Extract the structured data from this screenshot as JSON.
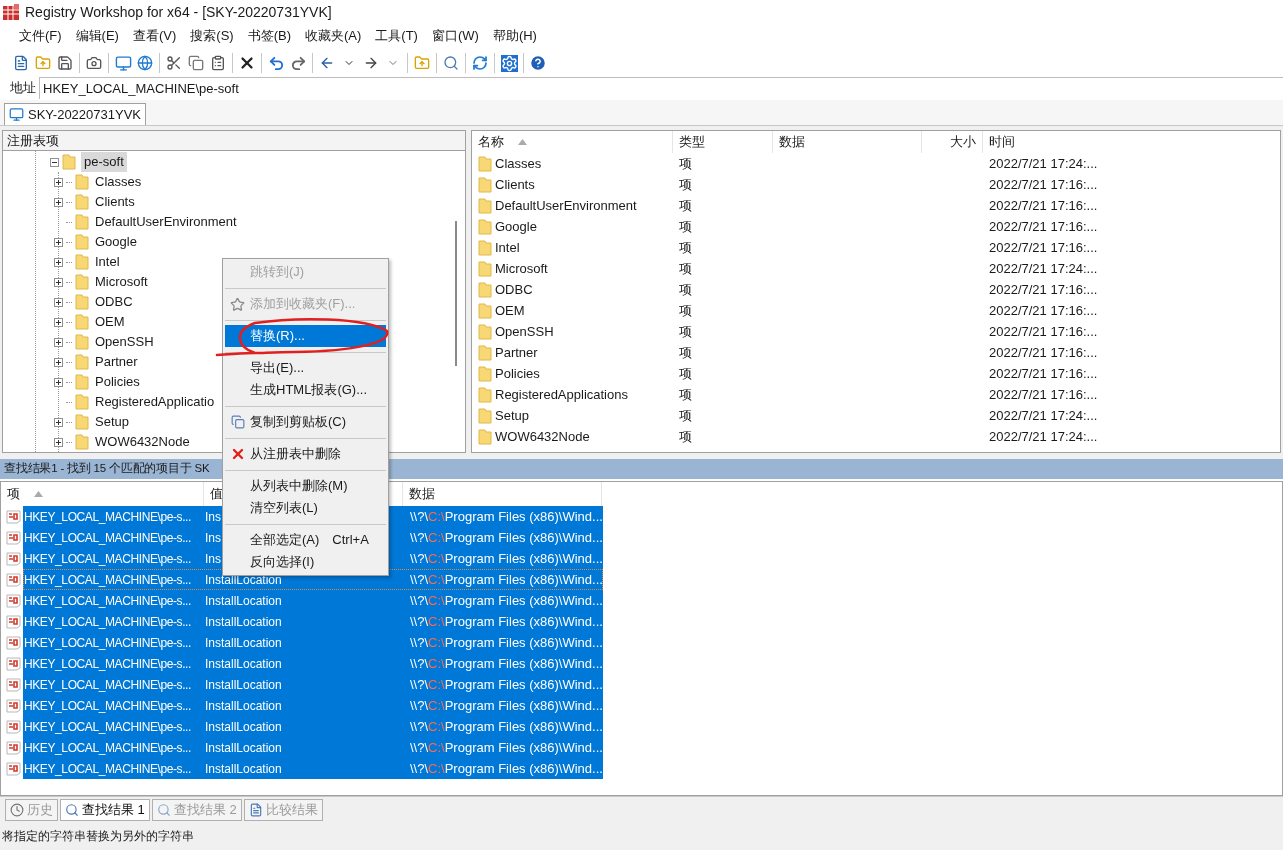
{
  "window": {
    "title": "Registry Workshop for x64 - [SKY-20220731YVK]"
  },
  "menu": [
    "文件(F)",
    "编辑(E)",
    "查看(V)",
    "搜索(S)",
    "书签(B)",
    "收藏夹(A)",
    "工具(T)",
    "窗口(W)",
    "帮助(H)"
  ],
  "address": {
    "label": "地址",
    "value": "HKEY_LOCAL_MACHINE\\pe-soft"
  },
  "computer_tab": {
    "label": "SKY-20220731YVK",
    "selected": true
  },
  "tree": {
    "header": "注册表项",
    "items": [
      {
        "label": "pe-soft",
        "selected": true,
        "expanded": true,
        "children": [
          {
            "label": "Classes",
            "expandable": true
          },
          {
            "label": "Clients",
            "expandable": true
          },
          {
            "label": "DefaultUserEnvironment",
            "expandable": false
          },
          {
            "label": "Google",
            "expandable": true
          },
          {
            "label": "Intel",
            "expandable": true
          },
          {
            "label": "Microsoft",
            "expandable": true
          },
          {
            "label": "ODBC",
            "expandable": true
          },
          {
            "label": "OEM",
            "expandable": true
          },
          {
            "label": "OpenSSH",
            "expandable": true
          },
          {
            "label": "Partner",
            "expandable": true
          },
          {
            "label": "Policies",
            "expandable": true
          },
          {
            "label": "RegisteredApplicatio",
            "expandable": false
          },
          {
            "label": "Setup",
            "expandable": true
          },
          {
            "label": "WOW6432Node",
            "expandable": true
          }
        ]
      }
    ]
  },
  "list": {
    "columns": [
      "名称",
      "类型",
      "数据",
      "大小",
      "时间"
    ],
    "rows": [
      {
        "name": "Classes",
        "type": "项",
        "time": "2022/7/21 17:24:..."
      },
      {
        "name": "Clients",
        "type": "项",
        "time": "2022/7/21 17:16:..."
      },
      {
        "name": "DefaultUserEnvironment",
        "type": "项",
        "time": "2022/7/21 17:16:..."
      },
      {
        "name": "Google",
        "type": "项",
        "time": "2022/7/21 17:16:..."
      },
      {
        "name": "Intel",
        "type": "项",
        "time": "2022/7/21 17:16:..."
      },
      {
        "name": "Microsoft",
        "type": "项",
        "time": "2022/7/21 17:24:..."
      },
      {
        "name": "ODBC",
        "type": "项",
        "time": "2022/7/21 17:16:..."
      },
      {
        "name": "OEM",
        "type": "项",
        "time": "2022/7/21 17:16:..."
      },
      {
        "name": "OpenSSH",
        "type": "项",
        "time": "2022/7/21 17:16:..."
      },
      {
        "name": "Partner",
        "type": "项",
        "time": "2022/7/21 17:16:..."
      },
      {
        "name": "Policies",
        "type": "项",
        "time": "2022/7/21 17:16:..."
      },
      {
        "name": "RegisteredApplications",
        "type": "项",
        "time": "2022/7/21 17:16:..."
      },
      {
        "name": "Setup",
        "type": "项",
        "time": "2022/7/21 17:24:..."
      },
      {
        "name": "WOW6432Node",
        "type": "项",
        "time": "2022/7/21 17:24:..."
      }
    ]
  },
  "results": {
    "title": "查找结果1 - 找到 15 个匹配的项目于 SK",
    "columns": [
      "项",
      "值",
      "数据"
    ],
    "rows": [
      {
        "item": "HKEY_LOCAL_MACHINE\\pe-s...",
        "value": "Ins",
        "data": [
          "\\\\?\\",
          "C:\\",
          "Program Files (x86)\\Wind..."
        ],
        "selected": true,
        "focused": false
      },
      {
        "item": "HKEY_LOCAL_MACHINE\\pe-s...",
        "value": "Ins",
        "data": [
          "\\\\?\\",
          "C:\\",
          "Program Files (x86)\\Wind..."
        ],
        "selected": true,
        "focused": false
      },
      {
        "item": "HKEY_LOCAL_MACHINE\\pe-s...",
        "value": "Ins",
        "data": [
          "\\\\?\\",
          "C:\\",
          "Program Files (x86)\\Wind..."
        ],
        "selected": true,
        "focused": false
      },
      {
        "item": "HKEY_LOCAL_MACHINE\\pe-s...",
        "value": "InstallLocation",
        "data": [
          "\\\\?\\",
          "C:\\",
          "Program Files (x86)\\Wind..."
        ],
        "selected": true,
        "focused": true
      },
      {
        "item": "HKEY_LOCAL_MACHINE\\pe-s...",
        "value": "InstallLocation",
        "data": [
          "\\\\?\\",
          "C:\\",
          "Program Files (x86)\\Wind..."
        ],
        "selected": true,
        "focused": false
      },
      {
        "item": "HKEY_LOCAL_MACHINE\\pe-s...",
        "value": "InstallLocation",
        "data": [
          "\\\\?\\",
          "C:\\",
          "Program Files (x86)\\Wind..."
        ],
        "selected": true,
        "focused": false
      },
      {
        "item": "HKEY_LOCAL_MACHINE\\pe-s...",
        "value": "InstallLocation",
        "data": [
          "\\\\?\\",
          "C:\\",
          "Program Files (x86)\\Wind..."
        ],
        "selected": true,
        "focused": false
      },
      {
        "item": "HKEY_LOCAL_MACHINE\\pe-s...",
        "value": "InstallLocation",
        "data": [
          "\\\\?\\",
          "C:\\",
          "Program Files (x86)\\Wind..."
        ],
        "selected": true,
        "focused": false
      },
      {
        "item": "HKEY_LOCAL_MACHINE\\pe-s...",
        "value": "InstallLocation",
        "data": [
          "\\\\?\\",
          "C:\\",
          "Program Files (x86)\\Wind..."
        ],
        "selected": true,
        "focused": false
      },
      {
        "item": "HKEY_LOCAL_MACHINE\\pe-s...",
        "value": "InstallLocation",
        "data": [
          "\\\\?\\",
          "C:\\",
          "Program Files (x86)\\Wind..."
        ],
        "selected": true,
        "focused": false
      },
      {
        "item": "HKEY_LOCAL_MACHINE\\pe-s...",
        "value": "InstallLocation",
        "data": [
          "\\\\?\\",
          "C:\\",
          "Program Files (x86)\\Wind..."
        ],
        "selected": true,
        "focused": false
      },
      {
        "item": "HKEY_LOCAL_MACHINE\\pe-s...",
        "value": "InstallLocation",
        "data": [
          "\\\\?\\",
          "C:\\",
          "Program Files (x86)\\Wind..."
        ],
        "selected": true,
        "focused": false
      },
      {
        "item": "HKEY_LOCAL_MACHINE\\pe-s...",
        "value": "InstallLocation",
        "data": [
          "\\\\?\\",
          "C:\\",
          "Program Files (x86)\\Wind..."
        ],
        "selected": true,
        "focused": false
      }
    ]
  },
  "context_menu": {
    "items": [
      {
        "kind": "item",
        "label": "跳转到(J)",
        "disabled": true,
        "selected": false
      },
      {
        "kind": "separator"
      },
      {
        "kind": "item",
        "label": "添加到收藏夹(F)...",
        "disabled": true,
        "selected": false
      },
      {
        "kind": "separator"
      },
      {
        "kind": "item",
        "label": "替换(R)...",
        "disabled": false,
        "selected": true
      },
      {
        "kind": "separator"
      },
      {
        "kind": "item",
        "label": "导出(E)...",
        "disabled": false,
        "selected": false
      },
      {
        "kind": "item",
        "label": "生成HTML报表(G)...",
        "disabled": false,
        "selected": false
      },
      {
        "kind": "separator"
      },
      {
        "kind": "item",
        "label": "复制到剪贴板(C)",
        "disabled": false,
        "selected": false
      },
      {
        "kind": "separator"
      },
      {
        "kind": "item",
        "label": "从注册表中删除",
        "disabled": false,
        "selected": false
      },
      {
        "kind": "separator"
      },
      {
        "kind": "item",
        "label": "从列表中删除(M)",
        "disabled": false,
        "selected": false
      },
      {
        "kind": "item",
        "label": "清空列表(L)",
        "disabled": false,
        "selected": false
      },
      {
        "kind": "separator"
      },
      {
        "kind": "item",
        "label": "全部选定(A)",
        "shortcut": "Ctrl+A",
        "disabled": false,
        "selected": false
      },
      {
        "kind": "item",
        "label": "反向选择(I)",
        "disabled": false,
        "selected": false
      }
    ]
  },
  "bottom_tabs": [
    {
      "label": "历史",
      "selected": false
    },
    {
      "label": "查找结果 1",
      "selected": true
    },
    {
      "label": "查找结果 2",
      "selected": false
    },
    {
      "label": "比较结果",
      "selected": false
    }
  ],
  "status_bar": "将指定的字符串替换为另外的字符串"
}
